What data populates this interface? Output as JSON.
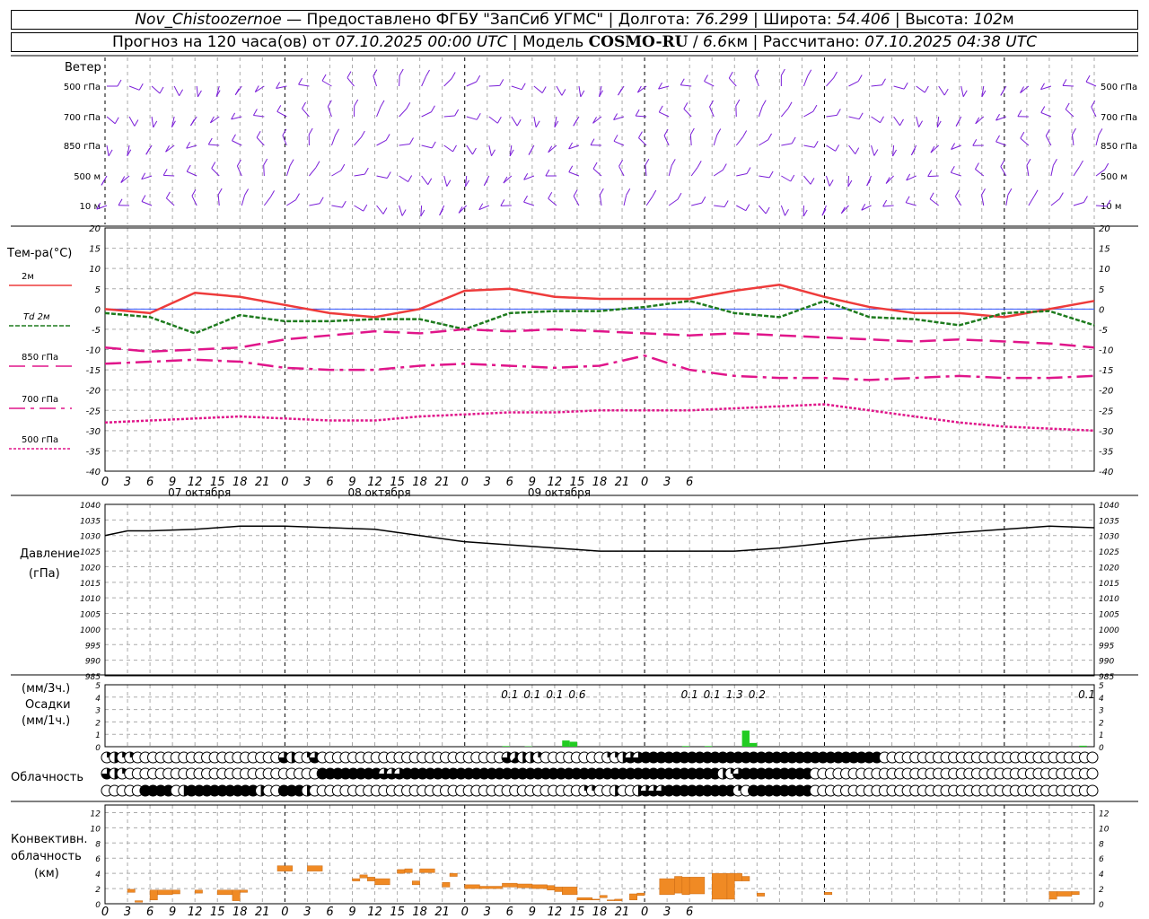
{
  "header": {
    "station": "Nov_Chistoozernoe",
    "provider": "Предоставлено ФГБУ \"ЗапСиб УГМС\"",
    "lon_label": "Долгота:",
    "lon": "76.299",
    "lat_label": "Широта:",
    "lat": "54.406",
    "alt_label": "Высота:",
    "alt": "102",
    "alt_unit": "м",
    "forecast_prefix": "Прогноз на 120 часа(ов) от",
    "forecast_start": "07.10.2025 00:00 UTC",
    "model_label": "Модель",
    "model": "COSMO-RU",
    "resolution": "6.6",
    "resolution_unit": "км",
    "calc_label": "Рассчитано:",
    "calc_time": "07.10.2025 04:38 UTC"
  },
  "wind_panel": {
    "title": "Ветер",
    "levels": [
      "500 гПа",
      "700 гПа",
      "850 гПа",
      "500 м",
      "10 м"
    ]
  },
  "temp_panel": {
    "title": "Тем-ра(°С)",
    "legend": [
      "2м",
      "Td  2м",
      "850 гПа",
      "700 гПа",
      "500 гПа"
    ]
  },
  "pressure_panel": {
    "title_line1": "Давление",
    "title_line2": "(гПа)"
  },
  "precip_panel": {
    "line1": "(мм/3ч.)",
    "line2": "Осадки",
    "line3": "(мм/1ч.)"
  },
  "cloud_panel": {
    "title": "Облачность"
  },
  "conv_panel": {
    "line1": "Конвективн.",
    "line2": "облачность",
    "line3": "(км)"
  },
  "x_tick_labels": [
    "0",
    "3",
    "6",
    "9",
    "12",
    "15",
    "18",
    "21",
    "0",
    "3",
    "6",
    "9",
    "12",
    "15",
    "18",
    "21",
    "0",
    "3",
    "6",
    "9",
    "12",
    "15",
    "18",
    "21",
    "0",
    "3",
    "6"
  ],
  "day_labels": [
    "07 октября",
    "08 октября",
    "09 октября"
  ],
  "colors": {
    "wind": "#7b1fd8",
    "t2m": "#ee3b3b",
    "td2m": "#1e7b1e",
    "magenta": "#e0158a",
    "precip": "#22cc22",
    "conv": "#f08a24",
    "pressure": "#000000",
    "zero_line": "#3355ff"
  },
  "chart_data": [
    {
      "type": "line",
      "name": "temperature",
      "x_hours": [
        0,
        6,
        12,
        18,
        24,
        30,
        36,
        42,
        48,
        54,
        60,
        66,
        72,
        78,
        84,
        90,
        96,
        102,
        108,
        114,
        120,
        126,
        132
      ],
      "ylim": [
        -40,
        20
      ],
      "yticks": [
        20,
        15,
        10,
        5,
        0,
        -5,
        -10,
        -15,
        -20,
        -25,
        -30,
        -35,
        -40
      ],
      "series": [
        {
          "name": "2м",
          "values": [
            0,
            -1,
            4,
            3,
            1,
            -1,
            -2,
            0,
            4.5,
            5,
            3,
            2.5,
            2.5,
            2.5,
            4.5,
            6,
            3,
            0.5,
            -1,
            -1,
            -2,
            0,
            2
          ]
        },
        {
          "name": "Td  2м",
          "values": [
            -1,
            -2,
            -6,
            -1.5,
            -3,
            -3,
            -2.5,
            -2.5,
            -5,
            -1,
            -0.5,
            -0.5,
            0.5,
            2,
            -1,
            -2,
            2,
            -2,
            -2.5,
            -4,
            -1,
            -0.5,
            -4
          ]
        },
        {
          "name": "850 гПа",
          "values": [
            -9.5,
            -10.5,
            -10,
            -9.5,
            -7.5,
            -6.5,
            -5.5,
            -6,
            -5,
            -5.5,
            -5,
            -5.5,
            -6,
            -6.5,
            -6,
            -6.5,
            -7,
            -7.5,
            -8,
            -7.5,
            -8,
            -8.5,
            -9.5
          ]
        },
        {
          "name": "700 гПа",
          "values": [
            -13.5,
            -13,
            -12.5,
            -13,
            -14.5,
            -15,
            -15,
            -14,
            -13.5,
            -14,
            -14.5,
            -14,
            -11.5,
            -15,
            -16.5,
            -17,
            -17,
            -17.5,
            -17,
            -16.5,
            -17,
            -17,
            -16.5
          ]
        },
        {
          "name": "500 гПа",
          "values": [
            -28,
            -27.5,
            -27,
            -26.5,
            -27,
            -27.5,
            -27.5,
            -26.5,
            -26,
            -25.5,
            -25.5,
            -25,
            -25,
            -25,
            -24.5,
            -24,
            -23.5,
            -25,
            -26.5,
            -28,
            -29,
            -29.5,
            -30
          ]
        }
      ]
    },
    {
      "type": "line",
      "name": "pressure",
      "x_hours": [
        0,
        3,
        6,
        12,
        18,
        24,
        30,
        36,
        42,
        48,
        54,
        60,
        66,
        72,
        78,
        84,
        90,
        96,
        102,
        108,
        114,
        120,
        126,
        132
      ],
      "ylim": [
        985,
        1040
      ],
      "yticks": [
        1040,
        1035,
        1030,
        1025,
        1020,
        1015,
        1010,
        1005,
        1000,
        995,
        990,
        985
      ],
      "series": [
        {
          "name": "pressure",
          "values": [
            1030,
            1031.5,
            1031.5,
            1032,
            1033,
            1033,
            1032.5,
            1032,
            1030,
            1028,
            1027,
            1026,
            1025,
            1025,
            1025,
            1025,
            1026,
            1027.5,
            1029,
            1030,
            1031,
            1032,
            1033,
            1032.5
          ]
        }
      ]
    },
    {
      "type": "bar",
      "name": "precipitation",
      "ylim": [
        0,
        5
      ],
      "yticks": [
        5,
        4,
        3,
        2,
        1,
        0
      ],
      "three_hour_labels": [
        {
          "hour": 54,
          "text": "0.1"
        },
        {
          "hour": 57,
          "text": "0.1"
        },
        {
          "hour": 60,
          "text": "0.1"
        },
        {
          "hour": 63,
          "text": "0.6"
        },
        {
          "hour": 78,
          "text": "0.1"
        },
        {
          "hour": 81,
          "text": "0.1"
        },
        {
          "hour": 84,
          "text": "1.3"
        },
        {
          "hour": 87,
          "text": "0.2"
        },
        {
          "hour": 131,
          "text": "0.1"
        }
      ],
      "hourly": [
        {
          "hour": 54,
          "value": 0.05
        },
        {
          "hour": 57,
          "value": 0.03
        },
        {
          "hour": 62,
          "value": 0.5
        },
        {
          "hour": 63,
          "value": 0.4
        },
        {
          "hour": 78,
          "value": 0.05
        },
        {
          "hour": 81,
          "value": 0.05
        },
        {
          "hour": 86,
          "value": 1.3
        },
        {
          "hour": 87,
          "value": 0.3
        },
        {
          "hour": 131,
          "value": 0.08
        }
      ]
    },
    {
      "type": "table",
      "name": "cloud_cover_eighths",
      "rows": [
        {
          "level": "upper",
          "values": [
            2,
            4,
            2,
            2,
            0,
            0,
            0,
            0,
            0,
            0,
            0,
            0,
            0,
            0,
            0,
            0,
            0,
            0,
            0,
            0,
            0,
            0,
            0,
            6,
            4,
            0,
            2,
            6,
            0,
            0,
            0,
            0,
            0,
            0,
            0,
            0,
            0,
            0,
            0,
            0,
            0,
            0,
            0,
            0,
            0,
            0,
            0,
            0,
            0,
            0,
            0,
            0,
            6,
            5,
            4,
            4,
            2,
            0,
            0,
            0,
            0,
            0,
            0,
            0,
            0,
            2,
            2,
            4,
            6,
            6,
            8,
            8,
            8,
            8,
            8,
            8,
            8,
            8,
            8,
            8,
            8,
            8,
            8,
            8,
            8,
            8,
            8,
            8,
            8,
            8,
            8,
            8,
            8,
            8,
            8,
            8,
            8,
            8,
            8,
            8,
            8,
            0,
            0,
            0,
            0,
            0,
            0,
            0,
            0,
            0,
            0,
            0,
            0,
            0,
            0,
            0,
            0,
            0,
            0,
            0,
            0,
            0,
            0,
            0,
            0,
            0,
            0,
            0,
            0
          ]
        },
        {
          "level": "middle",
          "values": [
            6,
            4,
            2,
            0,
            0,
            0,
            0,
            0,
            0,
            0,
            0,
            0,
            0,
            0,
            0,
            0,
            0,
            0,
            0,
            0,
            0,
            0,
            0,
            0,
            0,
            0,
            0,
            0,
            8,
            8,
            8,
            8,
            8,
            8,
            8,
            8,
            6,
            6,
            6,
            8,
            8,
            8,
            8,
            8,
            8,
            8,
            8,
            8,
            8,
            8,
            8,
            8,
            8,
            8,
            8,
            8,
            8,
            8,
            8,
            8,
            8,
            8,
            8,
            8,
            8,
            8,
            8,
            8,
            8,
            8,
            8,
            8,
            8,
            8,
            8,
            8,
            8,
            8,
            8,
            8,
            4,
            2,
            6,
            8,
            8,
            8,
            8,
            8,
            8,
            8,
            8,
            8,
            0,
            0,
            0,
            0,
            0,
            0,
            0,
            0,
            0,
            0,
            0,
            0,
            0,
            0,
            0,
            0,
            0,
            0,
            0,
            0,
            0,
            0,
            0,
            0,
            0,
            0,
            0,
            0,
            0,
            0,
            0,
            0,
            0,
            0,
            0,
            0,
            0
          ]
        },
        {
          "level": "lower",
          "values": [
            0,
            0,
            0,
            0,
            0,
            8,
            8,
            8,
            8,
            0,
            4,
            8,
            8,
            8,
            8,
            8,
            8,
            8,
            8,
            8,
            4,
            0,
            0,
            8,
            8,
            8,
            4,
            0,
            0,
            0,
            0,
            0,
            0,
            0,
            0,
            0,
            0,
            0,
            0,
            0,
            0,
            0,
            0,
            0,
            0,
            0,
            0,
            0,
            0,
            0,
            0,
            0,
            0,
            0,
            0,
            0,
            0,
            0,
            0,
            0,
            0,
            0,
            2,
            2,
            0,
            0,
            4,
            0,
            0,
            4,
            6,
            6,
            6,
            8,
            8,
            8,
            8,
            8,
            8,
            8,
            8,
            8,
            2,
            0,
            8,
            8,
            8,
            8,
            8,
            8,
            8,
            8,
            0,
            0,
            0,
            0,
            0,
            0,
            0,
            0,
            0,
            0,
            0,
            0,
            0,
            0,
            0,
            0,
            0,
            0,
            0,
            0,
            0,
            0,
            0,
            0,
            0,
            0,
            0,
            0,
            0,
            0,
            0,
            0,
            0,
            0,
            0,
            0,
            0
          ]
        }
      ]
    },
    {
      "type": "bar",
      "name": "convective_cloud",
      "ylim": [
        0,
        13
      ],
      "yticks": [
        12,
        10,
        8,
        6,
        4,
        2,
        0
      ],
      "ranges": [
        {
          "h0": 3,
          "h1": 4,
          "base": 1.5,
          "top": 1.9
        },
        {
          "h0": 4,
          "h1": 5,
          "base": 0.2,
          "top": 0.4
        },
        {
          "h0": 6,
          "h1": 7,
          "base": 0.5,
          "top": 1.8
        },
        {
          "h0": 7,
          "h1": 9,
          "base": 1.2,
          "top": 1.8
        },
        {
          "h0": 9,
          "h1": 10,
          "base": 1.3,
          "top": 1.8
        },
        {
          "h0": 12,
          "h1": 13,
          "base": 1.4,
          "top": 1.8
        },
        {
          "h0": 15,
          "h1": 17,
          "base": 1.2,
          "top": 1.8
        },
        {
          "h0": 17,
          "h1": 18,
          "base": 0.4,
          "top": 1.8
        },
        {
          "h0": 18,
          "h1": 19,
          "base": 1.5,
          "top": 1.8
        },
        {
          "h0": 23,
          "h1": 25,
          "base": 4.3,
          "top": 5
        },
        {
          "h0": 27,
          "h1": 29,
          "base": 4.3,
          "top": 5
        },
        {
          "h0": 33,
          "h1": 34,
          "base": 3,
          "top": 3.3
        },
        {
          "h0": 34,
          "h1": 35,
          "base": 3.4,
          "top": 3.8
        },
        {
          "h0": 35,
          "h1": 36,
          "base": 3,
          "top": 3.5
        },
        {
          "h0": 36,
          "h1": 38,
          "base": 2.5,
          "top": 3.3
        },
        {
          "h0": 39,
          "h1": 40,
          "base": 4,
          "top": 4.5
        },
        {
          "h0": 40,
          "h1": 41,
          "base": 4.1,
          "top": 4.6
        },
        {
          "h0": 41,
          "h1": 42,
          "base": 2.5,
          "top": 3
        },
        {
          "h0": 42,
          "h1": 44,
          "base": 4.1,
          "top": 4.6
        },
        {
          "h0": 45,
          "h1": 46,
          "base": 2.2,
          "top": 2.8
        },
        {
          "h0": 46,
          "h1": 47,
          "base": 3.6,
          "top": 4
        },
        {
          "h0": 48,
          "h1": 50,
          "base": 2,
          "top": 2.5
        },
        {
          "h0": 50,
          "h1": 53,
          "base": 2,
          "top": 2.3
        },
        {
          "h0": 53,
          "h1": 55,
          "base": 2.2,
          "top": 2.7
        },
        {
          "h0": 55,
          "h1": 57,
          "base": 2.1,
          "top": 2.6
        },
        {
          "h0": 57,
          "h1": 59,
          "base": 2,
          "top": 2.5
        },
        {
          "h0": 59,
          "h1": 60,
          "base": 1.8,
          "top": 2.4
        },
        {
          "h0": 60,
          "h1": 61,
          "base": 1.6,
          "top": 2.2
        },
        {
          "h0": 61,
          "h1": 63,
          "base": 1.2,
          "top": 2.2
        },
        {
          "h0": 63,
          "h1": 65,
          "base": 0.5,
          "top": 0.8
        },
        {
          "h0": 65,
          "h1": 66,
          "base": 0.5,
          "top": 0.6
        },
        {
          "h0": 66,
          "h1": 67,
          "base": 0.8,
          "top": 1.1
        },
        {
          "h0": 67,
          "h1": 68,
          "base": 0.4,
          "top": 0.5
        },
        {
          "h0": 68,
          "h1": 69,
          "base": 0.4,
          "top": 0.6
        },
        {
          "h0": 70,
          "h1": 71,
          "base": 0.5,
          "top": 1.3
        },
        {
          "h0": 71,
          "h1": 72,
          "base": 1.1,
          "top": 1.4
        },
        {
          "h0": 74,
          "h1": 76,
          "base": 1.2,
          "top": 3.3
        },
        {
          "h0": 76,
          "h1": 77,
          "base": 1.4,
          "top": 3.6
        },
        {
          "h0": 77,
          "h1": 78,
          "base": 1.2,
          "top": 3.5
        },
        {
          "h0": 78,
          "h1": 80,
          "base": 1.3,
          "top": 3.5
        },
        {
          "h0": 81,
          "h1": 83,
          "base": 0.6,
          "top": 4
        },
        {
          "h0": 83,
          "h1": 84,
          "base": 0.6,
          "top": 4
        },
        {
          "h0": 84,
          "h1": 85,
          "base": 3,
          "top": 4
        },
        {
          "h0": 85,
          "h1": 86,
          "base": 3,
          "top": 3.6
        },
        {
          "h0": 87,
          "h1": 88,
          "base": 1,
          "top": 1.4
        },
        {
          "h0": 96,
          "h1": 97,
          "base": 1.2,
          "top": 1.5
        },
        {
          "h0": 126,
          "h1": 127,
          "base": 0.6,
          "top": 1.6
        },
        {
          "h0": 127,
          "h1": 129,
          "base": 1,
          "top": 1.6
        },
        {
          "h0": 129,
          "h1": 130,
          "base": 1.2,
          "top": 1.6
        }
      ]
    }
  ]
}
